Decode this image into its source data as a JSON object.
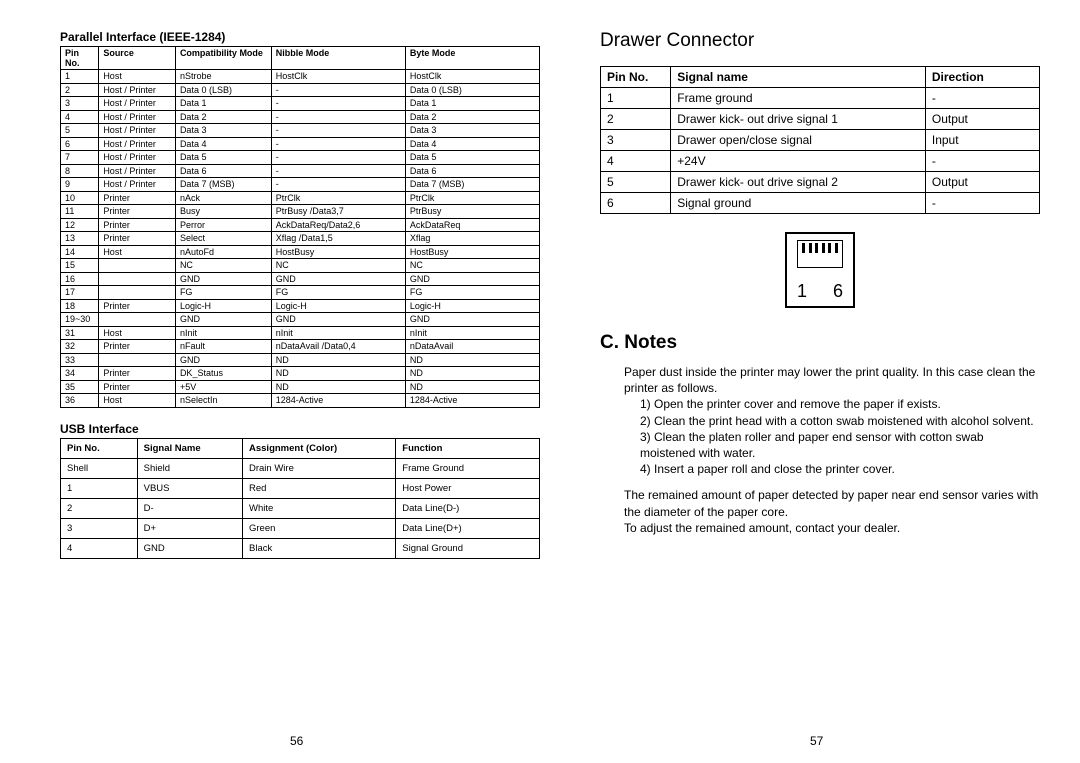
{
  "left": {
    "parallel_title": "Parallel Interface (IEEE-1284)",
    "parallel_headers": [
      "Pin No.",
      "Source",
      "Compatibility Mode",
      "Nibble Mode",
      "Byte Mode"
    ],
    "parallel_rows": [
      [
        "1",
        "Host",
        "nStrobe",
        "HostClk",
        "HostClk"
      ],
      [
        "2",
        "Host / Printer",
        "Data 0 (LSB)",
        "-",
        "Data 0 (LSB)"
      ],
      [
        "3",
        "Host / Printer",
        "Data 1",
        "-",
        "Data 1"
      ],
      [
        "4",
        "Host / Printer",
        "Data 2",
        "-",
        "Data 2"
      ],
      [
        "5",
        "Host / Printer",
        "Data 3",
        "-",
        "Data 3"
      ],
      [
        "6",
        "Host / Printer",
        "Data 4",
        "-",
        "Data 4"
      ],
      [
        "7",
        "Host / Printer",
        "Data 5",
        "-",
        "Data 5"
      ],
      [
        "8",
        "Host / Printer",
        "Data 6",
        "-",
        "Data 6"
      ],
      [
        "9",
        "Host / Printer",
        "Data 7 (MSB)",
        "-",
        "Data 7 (MSB)"
      ],
      [
        "10",
        "Printer",
        "nAck",
        "PtrClk",
        "PtrClk"
      ],
      [
        "11",
        "Printer",
        "Busy",
        "PtrBusy /Data3,7",
        "PtrBusy"
      ],
      [
        "12",
        "Printer",
        "Perror",
        "AckDataReq/Data2,6",
        "AckDataReq"
      ],
      [
        "13",
        "Printer",
        "Select",
        "Xflag /Data1,5",
        "Xflag"
      ],
      [
        "14",
        "Host",
        "nAutoFd",
        "HostBusy",
        "HostBusy"
      ],
      [
        "15",
        "",
        "NC",
        "NC",
        "NC"
      ],
      [
        "16",
        "",
        "GND",
        "GND",
        "GND"
      ],
      [
        "17",
        "",
        "FG",
        "FG",
        "FG"
      ],
      [
        "18",
        "Printer",
        "Logic-H",
        "Logic-H",
        "Logic-H"
      ],
      [
        "19~30",
        "",
        "GND",
        "GND",
        "GND"
      ],
      [
        "31",
        "Host",
        "nInit",
        "nInit",
        "nInit"
      ],
      [
        "32",
        "Printer",
        "nFault",
        "nDataAvail /Data0,4",
        "nDataAvail"
      ],
      [
        "33",
        "",
        "GND",
        "ND",
        "ND"
      ],
      [
        "34",
        "Printer",
        "DK_Status",
        "ND",
        "ND"
      ],
      [
        "35",
        "Printer",
        "+5V",
        "ND",
        "ND"
      ],
      [
        "36",
        "Host",
        "nSelectIn",
        "1284-Active",
        "1284-Active"
      ]
    ],
    "usb_title": "USB Interface",
    "usb_headers": [
      "Pin No.",
      "Signal Name",
      "Assignment   (Color)",
      "Function"
    ],
    "usb_rows": [
      [
        "Shell",
        "Shield",
        "Drain Wire",
        "Frame Ground"
      ],
      [
        "1",
        "VBUS",
        "Red",
        "Host Power"
      ],
      [
        "2",
        "D-",
        "White",
        "Data Line(D-)"
      ],
      [
        "3",
        "D+",
        "Green",
        "Data Line(D+)"
      ],
      [
        "4",
        "GND",
        "Black",
        "Signal Ground"
      ]
    ],
    "page_no": "56"
  },
  "right": {
    "drawer_title": "Drawer Connector",
    "drawer_headers": [
      "Pin No.",
      "Signal name",
      "Direction"
    ],
    "drawer_rows": [
      [
        "1",
        "Frame ground",
        "-"
      ],
      [
        "2",
        "Drawer kick- out drive signal 1",
        "Output"
      ],
      [
        "3",
        "Drawer open/close signal",
        "Input"
      ],
      [
        "4",
        "+24V",
        "-"
      ],
      [
        "5",
        "Drawer kick- out drive signal 2",
        "Output"
      ],
      [
        "6",
        "Signal ground",
        "-"
      ]
    ],
    "conn_labels": [
      "1",
      "6"
    ],
    "notes_heading": "C. Notes",
    "notes_intro": "Paper dust inside the printer may lower the print quality. In this case clean the printer as follows.",
    "notes_steps": [
      "1) Open the printer cover and remove the paper if exists.",
      "2) Clean the print head with a cotton swab moistened with alcohol solvent.",
      "3) Clean the platen roller and paper end sensor with cotton swab moistened with water.",
      "4) Insert a paper roll and close the printer cover."
    ],
    "notes_para2a": "The remained amount of paper detected by paper near end sensor varies with the diameter of the paper core.",
    "notes_para2b": "To adjust the remained amount, contact your dealer.",
    "page_no": "57"
  }
}
